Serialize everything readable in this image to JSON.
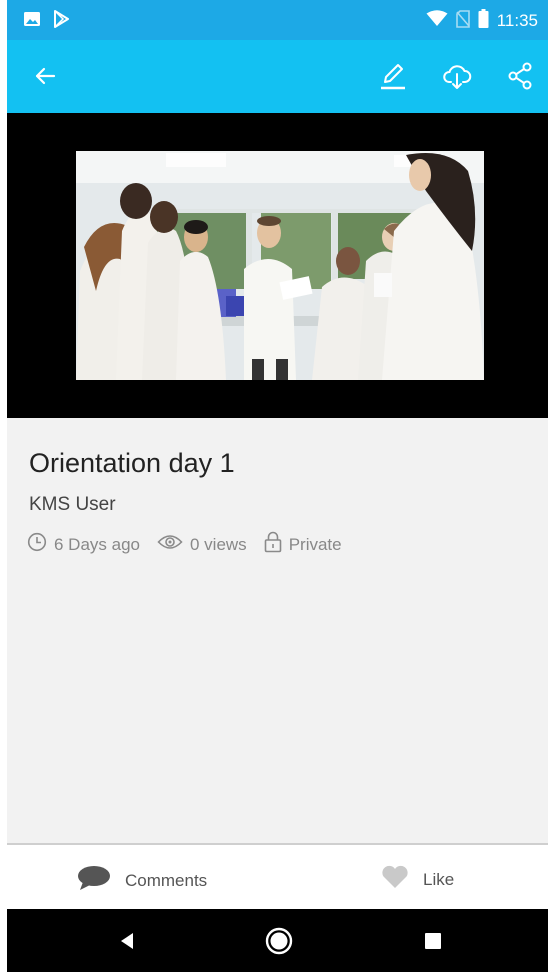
{
  "status_bar": {
    "time": "11:35",
    "icons": [
      "image-icon",
      "play-store-icon",
      "wifi-icon",
      "no-sim-icon",
      "battery-icon"
    ]
  },
  "app_bar": {
    "icons": [
      "back-arrow-icon",
      "edit-pencil-icon",
      "cloud-download-icon",
      "share-icon"
    ]
  },
  "media": {
    "title": "Orientation day 1",
    "owner": "KMS User",
    "meta": {
      "age": "6 Days ago",
      "views": "0 views",
      "privacy": "Private"
    }
  },
  "bottom_actions": {
    "comments_label": "Comments",
    "like_label": "Like"
  },
  "colors": {
    "status_bar": "#1da9e6",
    "app_bar": "#13c1f2",
    "background": "#f2f2f2",
    "nav_bar": "#000000"
  }
}
